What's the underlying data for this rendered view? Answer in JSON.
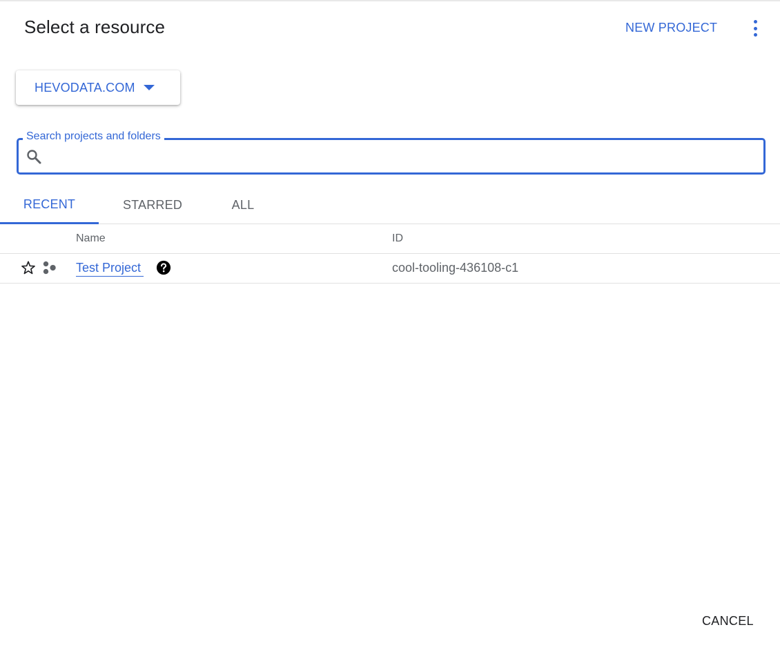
{
  "dialog": {
    "title": "Select a resource",
    "new_project_label": "NEW PROJECT",
    "more_icon": "more-vert-icon",
    "cancel_label": "CANCEL"
  },
  "org_picker": {
    "label": "HEVODATA.COM",
    "icon": "arrow-drop-down-icon"
  },
  "search": {
    "label": "Search projects and folders",
    "value": "",
    "placeholder": "",
    "icon": "search-icon"
  },
  "tabs": [
    {
      "label": "RECENT",
      "active": true
    },
    {
      "label": "STARRED",
      "active": false
    },
    {
      "label": "ALL",
      "active": false
    }
  ],
  "table": {
    "columns": [
      "Name",
      "ID"
    ],
    "rows": [
      {
        "starred": false,
        "type_icon": "project-icon",
        "name": "Test Project",
        "help_icon": "help-icon",
        "id": "cool-tooling-436108-c1"
      }
    ]
  },
  "colors": {
    "accent": "#3367d6",
    "text": "#202124",
    "secondary_text": "#5f6368",
    "divider": "#e0e0e0"
  }
}
